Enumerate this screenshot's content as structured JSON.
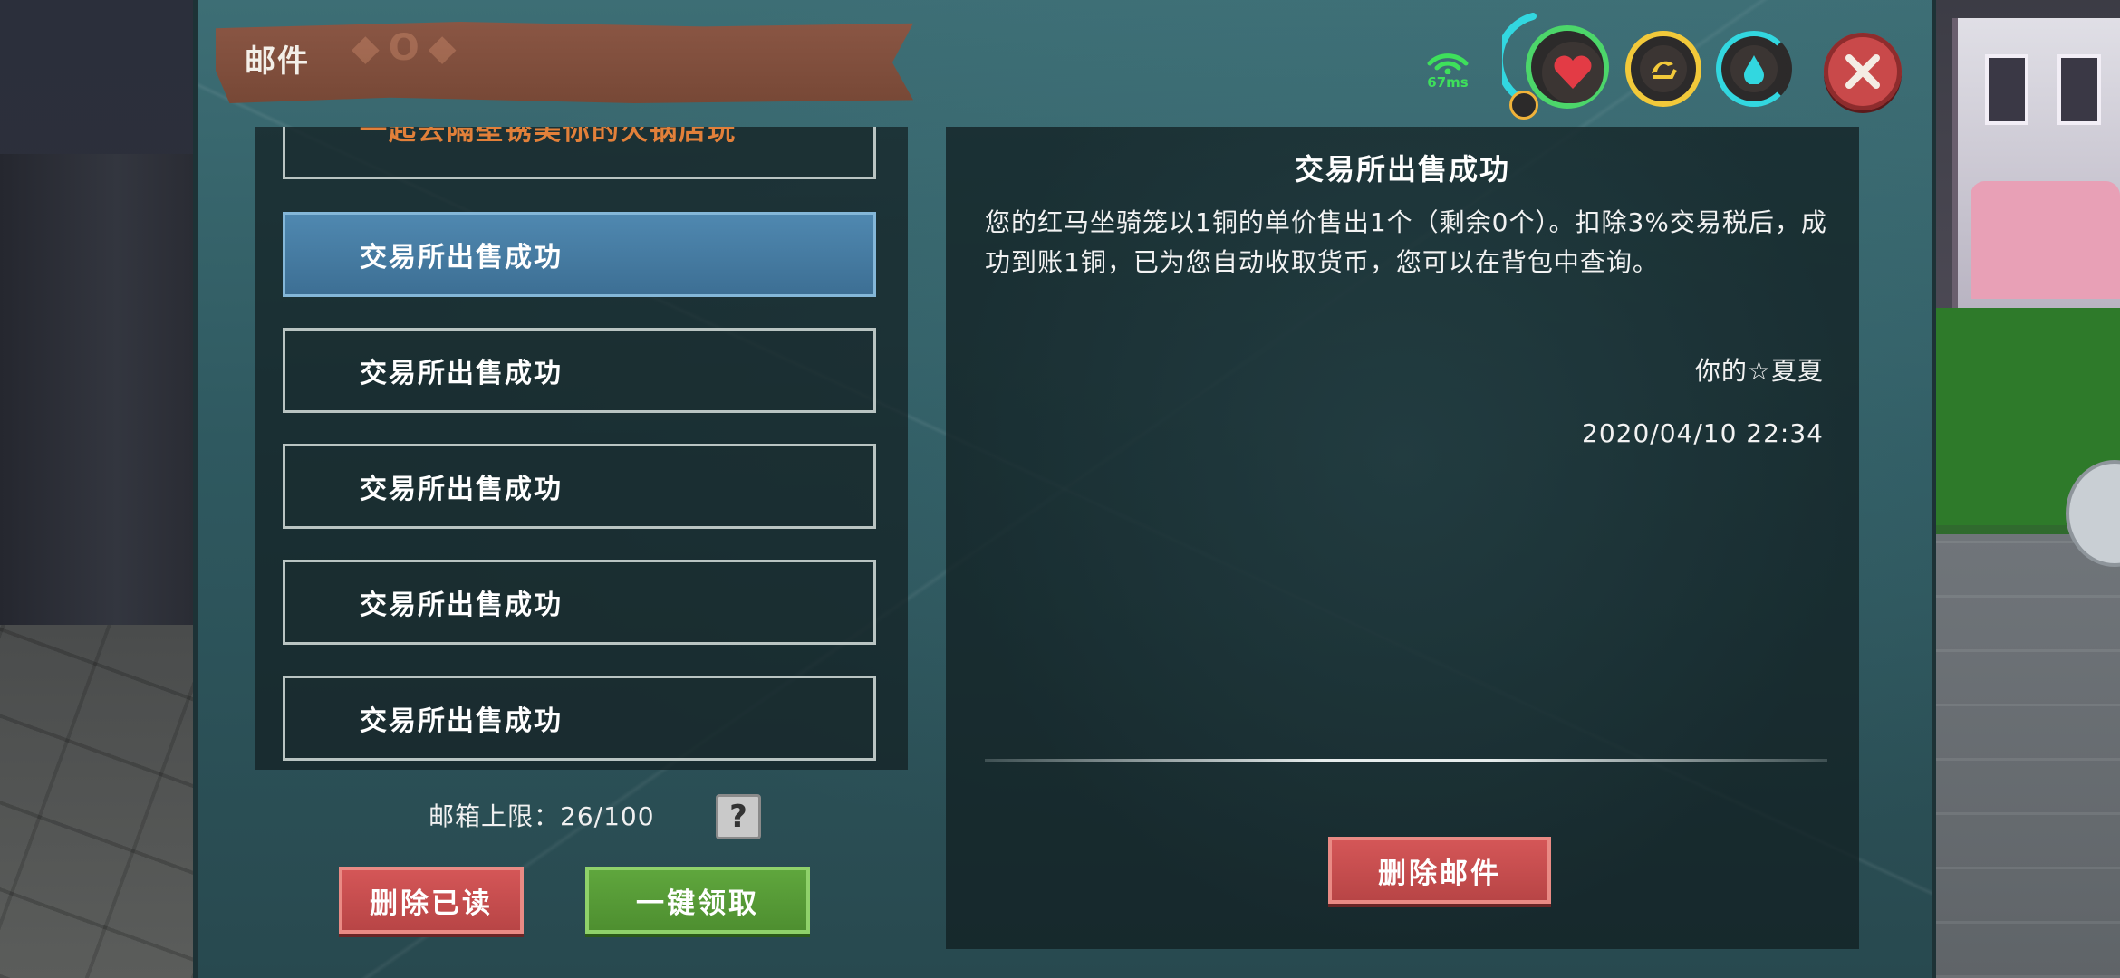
{
  "header": {
    "title": "邮件",
    "ping": "67ms",
    "icons": [
      "wifi-icon",
      "heart-icon",
      "stamina-icon",
      "water-icon",
      "close-icon"
    ],
    "colors": {
      "ping": "#3ee05b",
      "gauge_green": "#4cd66a",
      "gauge_yellow": "#f2c93a",
      "gauge_cyan": "#32d7e0"
    }
  },
  "mail_list": {
    "items": [
      {
        "title": "一起去隔壁锈美你的火锅店玩",
        "state": "partial"
      },
      {
        "title": "交易所出售成功",
        "state": "selected"
      },
      {
        "title": "交易所出售成功",
        "state": "normal"
      },
      {
        "title": "交易所出售成功",
        "state": "normal"
      },
      {
        "title": "交易所出售成功",
        "state": "normal"
      },
      {
        "title": "交易所出售成功",
        "state": "normal"
      }
    ],
    "quota_label": "邮箱上限：26/100",
    "help_label": "?",
    "delete_read_label": "删除已读",
    "claim_all_label": "一键领取"
  },
  "detail": {
    "title": "交易所出售成功",
    "body": "您的红马坐骑笼以1铜的单价售出1个（剩余0个）。扣除3%交易税后，成功到账1铜，已为您自动收取货币，您可以在背包中查询。",
    "sender": "你的☆夏夏",
    "date": "2020/04/10 22:34",
    "delete_label": "删除邮件"
  }
}
